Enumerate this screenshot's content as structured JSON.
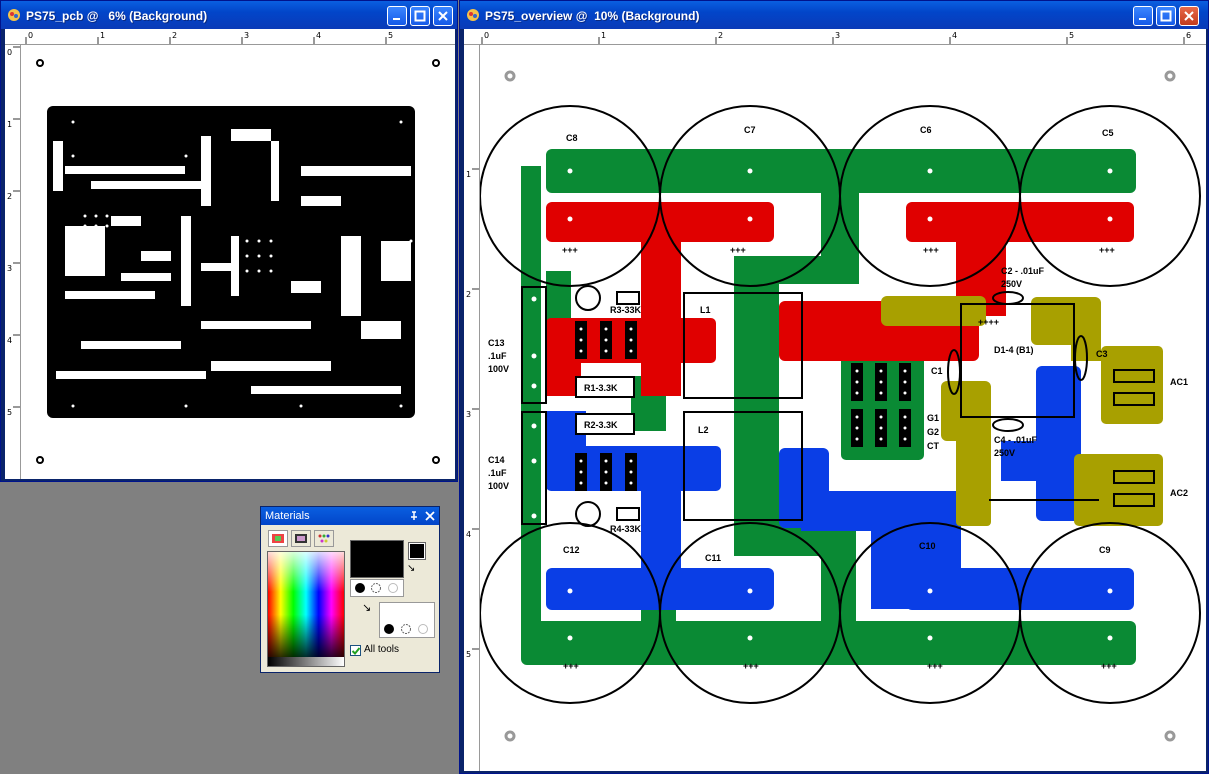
{
  "window1": {
    "title": "PS75_pcb @   6% (Background)"
  },
  "window2": {
    "title": "PS75_overview @  10% (Background)"
  },
  "ruler_small": {
    "h_labels": [
      "0",
      "1",
      "2",
      "3",
      "4",
      "5"
    ],
    "v_labels": [
      "0",
      "1",
      "2",
      "3",
      "4",
      "5"
    ]
  },
  "ruler_large": {
    "h_labels": [
      "0",
      "1",
      "2",
      "3",
      "4",
      "5",
      "6"
    ],
    "v_labels": [
      "1",
      "2",
      "3",
      "4",
      "5"
    ]
  },
  "materials": {
    "title": "Materials",
    "all_tools_label": "All tools",
    "all_tools_checked": true
  },
  "overview": {
    "capacitors_top": [
      "C8",
      "C7",
      "C6",
      "C5"
    ],
    "capacitors_bottom": [
      "C12",
      "C11",
      "C10",
      "C9"
    ],
    "plus_mark": "+++",
    "plus4_mark": "++++",
    "r3": "R3-33K",
    "r4": "R4-33K",
    "r1": "R1-3.3K",
    "r2": "R2-3.3K",
    "c13": [
      "C13",
      ".1uF",
      "100V"
    ],
    "c14": [
      "C14",
      ".1uF",
      "100V"
    ],
    "l1": "L1",
    "l2": "L2",
    "g_labels": [
      "G1",
      "G2",
      "CT"
    ],
    "c2": [
      "C2 - .01uF",
      "250V"
    ],
    "c4": [
      "C4 - .01uF",
      "250V"
    ],
    "d14": "D1-4 (B1)",
    "c1": "C1",
    "c3": "C3",
    "ac1": "AC1",
    "ac2": "AC2"
  },
  "colors": {
    "green": "#0a8a34",
    "red": "#e00000",
    "blue": "#0a3ee6",
    "olive": "#a8a000"
  }
}
